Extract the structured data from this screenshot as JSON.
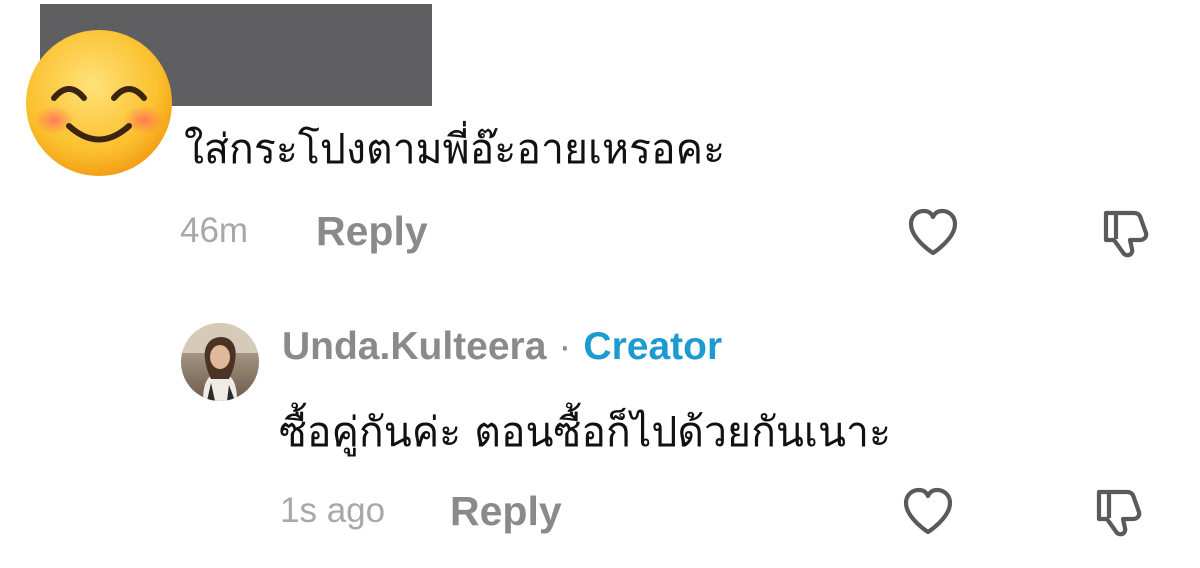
{
  "comments": [
    {
      "author_avatar_icon": "smiling-face-emoji-icon",
      "text": "ใส่กระโปงตามพี่อ๊ะอายเหรอคะ",
      "time": "46m",
      "reply_label": "Reply",
      "like_icon": "heart-outline-icon",
      "dislike_icon": "thumbs-down-outline-icon"
    }
  ],
  "reply": {
    "username": "Unda.Kulteera",
    "separator": "·",
    "badge": "Creator",
    "text": "ซื้อคู่กันค่ะ ตอนซื้อก็ไปด้วยกันเนาะ",
    "time": "1s ago",
    "reply_label": "Reply",
    "like_icon": "heart-outline-icon",
    "dislike_icon": "thumbs-down-outline-icon"
  },
  "colors": {
    "redaction": "#5f5f62",
    "meta_text": "#a8a8a8",
    "reply_text": "#8a8a8a",
    "creator_badge": "#1d9bd1",
    "comment_text": "#111111"
  }
}
